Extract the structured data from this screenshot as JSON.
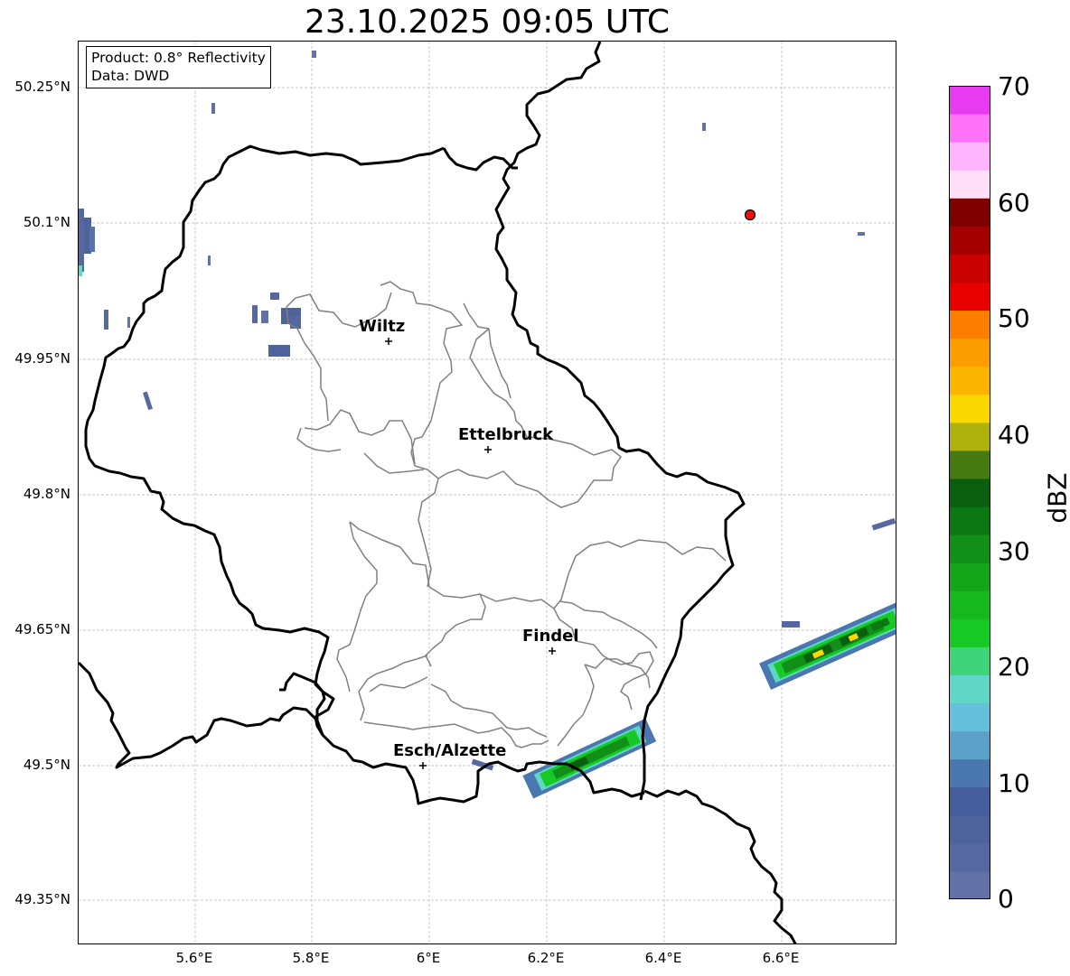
{
  "title": "23.10.2025 09:05 UTC",
  "info": {
    "product": "Product: 0.8° Reflectivity",
    "data": "Data: DWD"
  },
  "axes": {
    "lat_ticks": [
      "50.25°N",
      "50.1°N",
      "49.95°N",
      "49.8°N",
      "49.65°N",
      "49.5°N",
      "49.35°N"
    ],
    "lon_ticks": [
      "5.6°E",
      "5.8°E",
      "6°E",
      "6.2°E",
      "6.4°E",
      "6.6°E"
    ],
    "grid": true
  },
  "cities": [
    {
      "name": "Wiltz"
    },
    {
      "name": "Ettelbruck"
    },
    {
      "name": "Findel"
    },
    {
      "name": "Esch/Alzette"
    }
  ],
  "colorbar": {
    "label": "dBZ",
    "ticks": [
      "70",
      "60",
      "50",
      "40",
      "30",
      "20",
      "10",
      "0"
    ],
    "colors": [
      "#6271a8",
      "#56689f",
      "#4d639a",
      "#455e9e",
      "#4a77b0",
      "#5da1c8",
      "#66bfdc",
      "#5fd6c6",
      "#3fd37a",
      "#16c925",
      "#16b91d",
      "#14a51b",
      "#128f19",
      "#0b7712",
      "#0a5f0f",
      "#477a10",
      "#afb20d",
      "#fdd700",
      "#fbb400",
      "#fb9d00",
      "#fb7e00",
      "#e80000",
      "#c90000",
      "#a40000",
      "#7e0000",
      "#ffdff8",
      "#ffb4fb",
      "#ff73f8",
      "#e83af0"
    ]
  },
  "colors": {
    "border": "#000000",
    "canton": "#808080",
    "grid": "#b0b0b0",
    "station": "#ee1111"
  }
}
